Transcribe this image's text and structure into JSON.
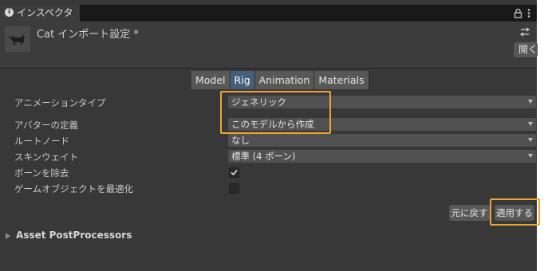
{
  "window": {
    "tab_title": "インスペクター*"
  },
  "header": {
    "title": "Cat インポート設定 *",
    "open_label": "開く"
  },
  "tabs": [
    {
      "label": "Model",
      "active": false
    },
    {
      "label": "Rig",
      "active": true
    },
    {
      "label": "Animation",
      "active": false
    },
    {
      "label": "Materials",
      "active": false
    }
  ],
  "rig": {
    "animation_type_label": "アニメーションタイプ",
    "animation_type_value": "ジェネリック",
    "avatar_def_label": "アバターの定義",
    "avatar_def_value": "このモデルから作成",
    "root_node_label": "ルートノード",
    "root_node_value": "なし",
    "skin_weights_label": "スキンウェイト",
    "skin_weights_value": "標準 (4 ボーン)",
    "strip_bones_label": "ボーンを除去",
    "strip_bones_checked": true,
    "optimize_go_label": "ゲームオブジェクトを最適化",
    "optimize_go_checked": false
  },
  "actions": {
    "revert_label": "元に戻す",
    "apply_label": "適用する"
  },
  "postprocessors": {
    "label": "Asset PostProcessors"
  },
  "colors": {
    "highlight": "#f0a52e",
    "active_tab": "#46607c",
    "panel": "#383838"
  }
}
